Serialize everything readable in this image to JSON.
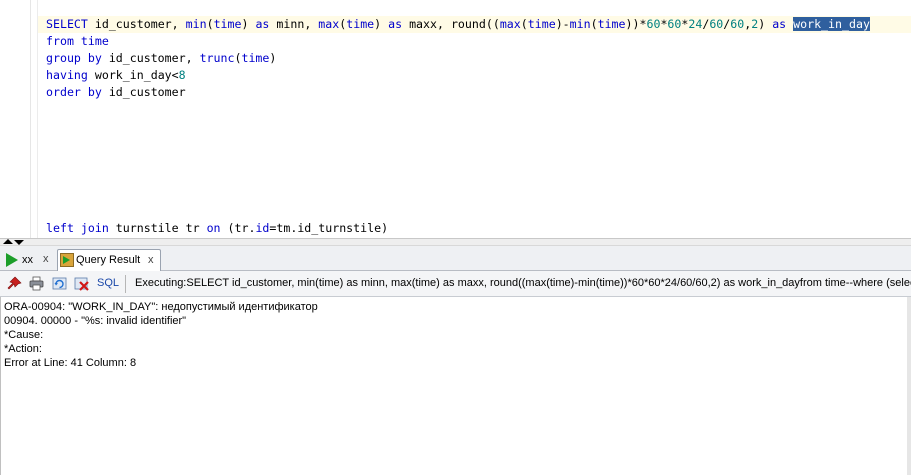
{
  "editor": {
    "lines": [
      {
        "parts": [
          {
            "t": "SELECT",
            "c": "kw"
          },
          {
            "t": " id_customer, ",
            "c": ""
          },
          {
            "t": "min",
            "c": "fn"
          },
          {
            "t": "(",
            "c": ""
          },
          {
            "t": "time",
            "c": "kw"
          },
          {
            "t": ") ",
            "c": ""
          },
          {
            "t": "as",
            "c": "kw"
          },
          {
            "t": " minn, ",
            "c": ""
          },
          {
            "t": "max",
            "c": "fn"
          },
          {
            "t": "(",
            "c": ""
          },
          {
            "t": "time",
            "c": "kw"
          },
          {
            "t": ") ",
            "c": ""
          },
          {
            "t": "as",
            "c": "kw"
          },
          {
            "t": " maxx, round((",
            "c": ""
          },
          {
            "t": "max",
            "c": "fn"
          },
          {
            "t": "(",
            "c": ""
          },
          {
            "t": "time",
            "c": "kw"
          },
          {
            "t": ")-",
            "c": ""
          },
          {
            "t": "min",
            "c": "fn"
          },
          {
            "t": "(",
            "c": ""
          },
          {
            "t": "time",
            "c": "kw"
          },
          {
            "t": "))*",
            "c": ""
          },
          {
            "t": "60",
            "c": "num"
          },
          {
            "t": "*",
            "c": ""
          },
          {
            "t": "60",
            "c": "num"
          },
          {
            "t": "*",
            "c": ""
          },
          {
            "t": "24",
            "c": "num"
          },
          {
            "t": "/",
            "c": ""
          },
          {
            "t": "60",
            "c": "num"
          },
          {
            "t": "/",
            "c": ""
          },
          {
            "t": "60",
            "c": "num"
          },
          {
            "t": ",",
            "c": ""
          },
          {
            "t": "2",
            "c": "num"
          },
          {
            "t": ") ",
            "c": ""
          },
          {
            "t": "as",
            "c": "kw"
          },
          {
            "t": " ",
            "c": ""
          },
          {
            "t": "work_in_day",
            "c": "sel"
          }
        ]
      },
      {
        "parts": [
          {
            "t": "from",
            "c": "kw"
          },
          {
            "t": " ",
            "c": ""
          },
          {
            "t": "time",
            "c": "kw"
          }
        ]
      },
      {
        "parts": [
          {
            "t": "group by",
            "c": "kw"
          },
          {
            "t": " id_customer, ",
            "c": ""
          },
          {
            "t": "trunc",
            "c": "fn"
          },
          {
            "t": "(",
            "c": ""
          },
          {
            "t": "time",
            "c": "kw"
          },
          {
            "t": ")",
            "c": ""
          }
        ]
      },
      {
        "parts": [
          {
            "t": "having",
            "c": "kw"
          },
          {
            "t": " work_in_day<",
            "c": ""
          },
          {
            "t": "8",
            "c": "num"
          }
        ]
      },
      {
        "parts": [
          {
            "t": "order by",
            "c": "kw"
          },
          {
            "t": " id_customer",
            "c": ""
          }
        ]
      },
      {
        "parts": [
          {
            "t": "left join",
            "c": "kw"
          },
          {
            "t": " turnstile tr ",
            "c": ""
          },
          {
            "t": "on",
            "c": "kw"
          },
          {
            "t": " (tr.",
            "c": ""
          },
          {
            "t": "id",
            "c": "kw"
          },
          {
            "t": "=tm.id_turnstile)",
            "c": ""
          }
        ]
      }
    ]
  },
  "tabs": {
    "xx": {
      "label": "xx",
      "close": "x"
    },
    "query": {
      "label": "Query Result",
      "close": "x"
    }
  },
  "toolbar": {
    "sql_label": "SQL",
    "executing": "Executing:SELECT id_customer, min(time) as minn, max(time) as maxx, round((max(time)-min(time))*60*60*24/60/60,2) as work_in_dayfrom time--where (select"
  },
  "output": {
    "lines": [
      "ORA-00904: \"WORK_IN_DAY\": недопустимый идентификатор",
      "00904. 00000 -  \"%s: invalid identifier\"",
      "*Cause:",
      "*Action:",
      "Error at Line: 41 Column: 8"
    ]
  },
  "colors": {
    "keyword": "#0000cc",
    "number": "#008080",
    "selection": "#2f5f9e",
    "run_icon": "#1c9e2a"
  }
}
